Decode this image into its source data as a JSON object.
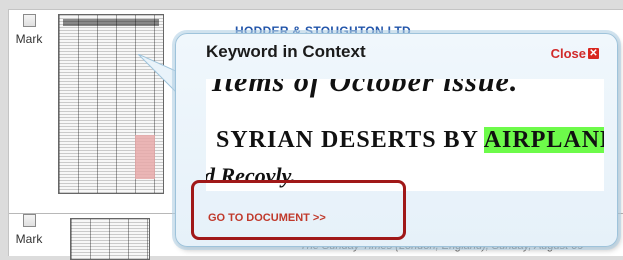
{
  "results": [
    {
      "mark_label": "Mark",
      "title": "HODDER & STOUGHTON LTD"
    },
    {
      "mark_label": "Mark",
      "meta": "The Sunday Times (London, England), Sunday, August 09"
    }
  ],
  "popup": {
    "title": "Keyword in Context",
    "close_label": "Close",
    "snippet_line1": "Items of October issue.",
    "snippet_line2_before": "SYRIAN DESERTS BY ",
    "snippet_keyword": "AIRPLANE",
    "snippet_line2_after": ";",
    "snippet_line3": "d Recovly.",
    "goto_label": "GO TO DOCUMENT >>"
  },
  "colors": {
    "keyword_highlight": "#6dfb4a",
    "link_red": "#c0392b",
    "callout_border": "#a01818",
    "title_blue": "#2255aa"
  },
  "icons": [
    "close-icon",
    "popup-pointer"
  ]
}
